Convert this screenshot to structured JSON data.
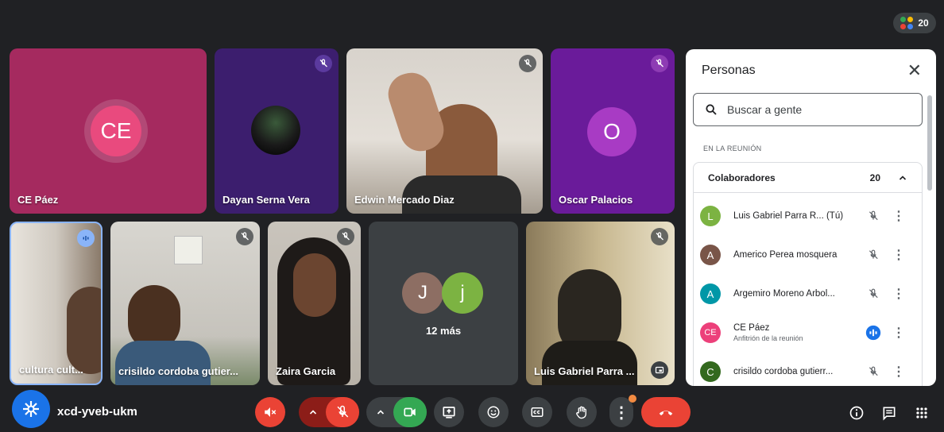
{
  "top": {
    "participant_count": "20",
    "dot_colors": [
      "#34a853",
      "#fbbc04",
      "#ea4335",
      "#4285f4"
    ]
  },
  "tiles": {
    "ce_paez": {
      "name": "CE Páez",
      "initials": "CE",
      "bg": "#a52a5f",
      "avatar_bg": "#e94a7e"
    },
    "dayan": {
      "name": "Dayan Serna Vera",
      "bg": "#3c1e6e"
    },
    "edwin": {
      "name": "Edwin Mercado Diaz"
    },
    "oscar": {
      "name": "Oscar Palacios",
      "initial": "O",
      "bg": "#6a1b9a",
      "avatar_bg": "#a83bc4"
    },
    "cultura": {
      "name": "cultura cult..."
    },
    "crisildo": {
      "name": "crisildo cordoba gutier..."
    },
    "zaira": {
      "name": "Zaira Garcia"
    },
    "more": {
      "label": "12 más",
      "avatar1": "J",
      "avatar2": "j"
    },
    "luis": {
      "name": "Luis Gabriel Parra ..."
    }
  },
  "panel": {
    "title": "Personas",
    "close": "✕",
    "search_placeholder": "Buscar a gente",
    "section_label": "EN LA REUNIÓN",
    "group_label": "Colaboradores",
    "group_count": "20",
    "people": [
      {
        "initial": "L",
        "name": "Luis Gabriel Parra R... (Tú)",
        "sub": "",
        "color": "#7cb342"
      },
      {
        "initial": "A",
        "name": "Americo Perea mosquera",
        "sub": "",
        "color": "#795548"
      },
      {
        "initial": "A",
        "name": "Argemiro Moreno Arbol...",
        "sub": "",
        "color": "#0097a7"
      },
      {
        "initial": "CE",
        "name": "CE Páez",
        "sub": "Anfitrión de la reunión",
        "color": "#ec407a"
      },
      {
        "initial": "C",
        "name": "crisildo cordoba gutierr...",
        "sub": "",
        "color": "#33691e"
      }
    ]
  },
  "bottom": {
    "meeting_code": "xcd-yveb-ukm"
  }
}
